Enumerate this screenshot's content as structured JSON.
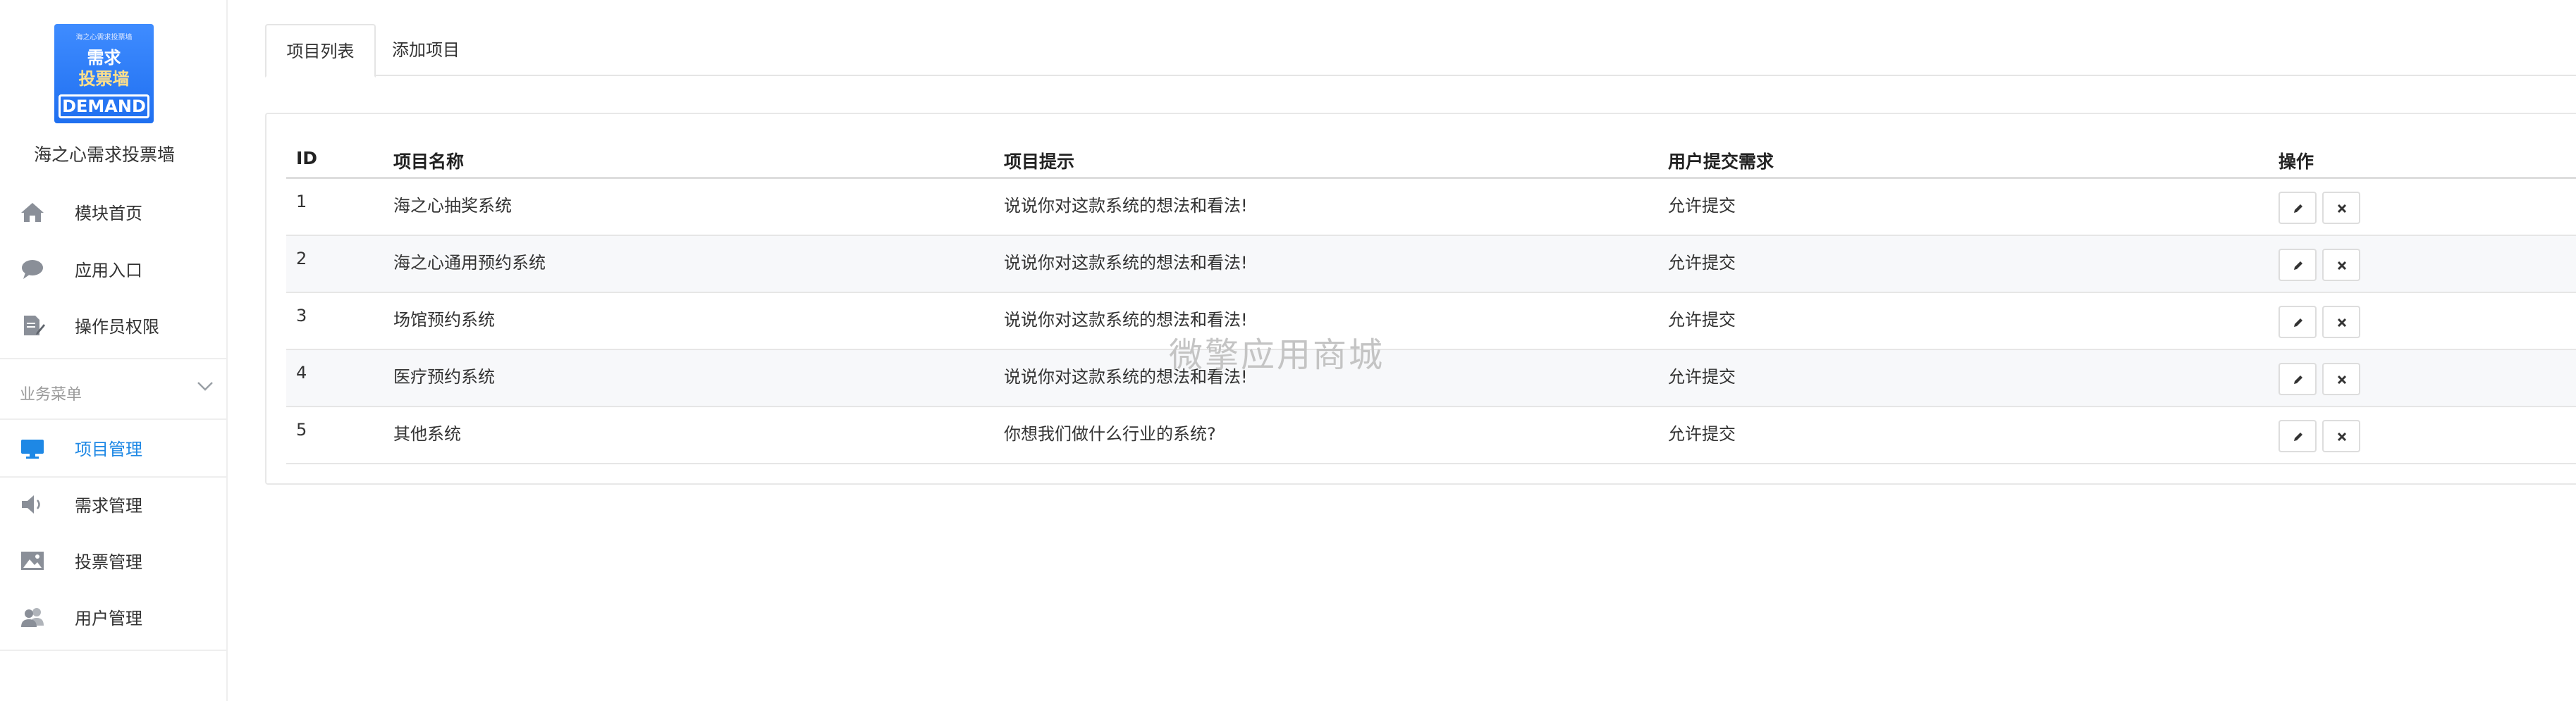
{
  "sidebar": {
    "logo": {
      "top_text": "海之心需求投票墙",
      "line1": "需求",
      "line2": "投票墙",
      "bottom_text": "DEMAND"
    },
    "brand_name": "海之心需求投票墙",
    "top_items": [
      {
        "label": "模块首页",
        "icon": "home-icon"
      },
      {
        "label": "应用入口",
        "icon": "chat-bubble-icon"
      },
      {
        "label": "操作员权限",
        "icon": "edit-document-icon"
      }
    ],
    "group_title": "业务菜单",
    "group_items": [
      {
        "label": "项目管理",
        "icon": "monitor-icon",
        "active": true
      },
      {
        "label": "需求管理",
        "icon": "speaker-icon"
      },
      {
        "label": "投票管理",
        "icon": "picture-icon"
      },
      {
        "label": "用户管理",
        "icon": "users-icon"
      }
    ]
  },
  "tabs": [
    {
      "label": "项目列表",
      "active": true
    },
    {
      "label": "添加项目",
      "active": false
    }
  ],
  "table": {
    "headers": {
      "id": "ID",
      "name": "项目名称",
      "hint": "项目提示",
      "submit": "用户提交需求",
      "actions": "操作"
    },
    "rows": [
      {
        "id": "1",
        "name": "海之心抽奖系统",
        "hint": "说说你对这款系统的想法和看法!",
        "submit": "允许提交"
      },
      {
        "id": "2",
        "name": "海之心通用预约系统",
        "hint": "说说你对这款系统的想法和看法!",
        "submit": "允许提交"
      },
      {
        "id": "3",
        "name": "场馆预约系统",
        "hint": "说说你对这款系统的想法和看法!",
        "submit": "允许提交"
      },
      {
        "id": "4",
        "name": "医疗预约系统",
        "hint": "说说你对这款系统的想法和看法!",
        "submit": "允许提交"
      },
      {
        "id": "5",
        "name": "其他系统",
        "hint": "你想我们做什么行业的系统?",
        "submit": "允许提交"
      }
    ],
    "row_actions": [
      {
        "icon": "pencil-icon"
      },
      {
        "icon": "close-icon"
      }
    ]
  },
  "watermark": "微擎应用商城",
  "colors": {
    "accent": "#1e88e5",
    "icon_gray": "#8a8f98",
    "logo_blue": "#2f7df6"
  }
}
